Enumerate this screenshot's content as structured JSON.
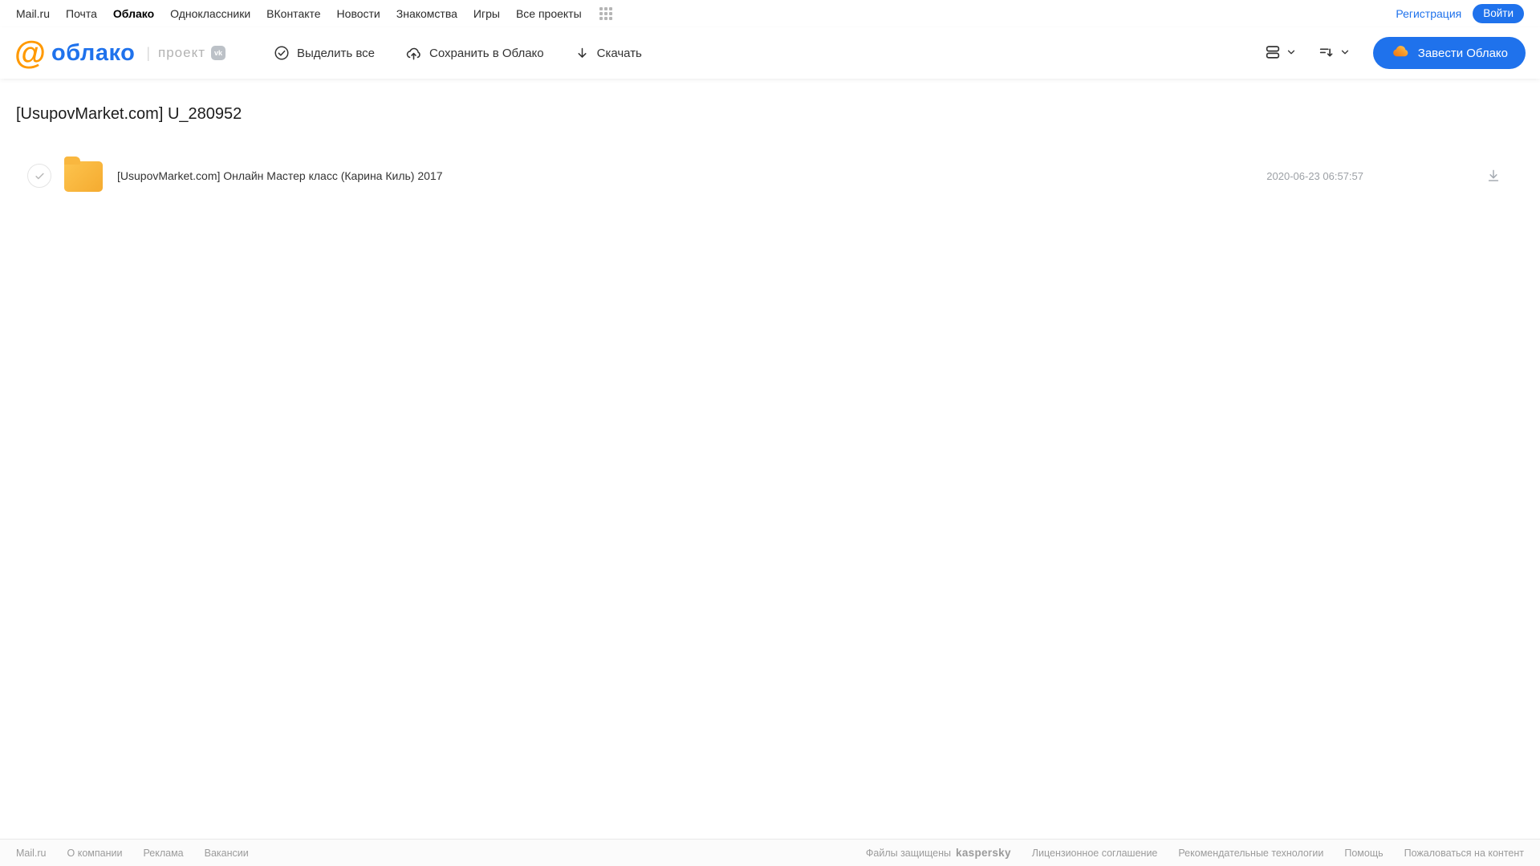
{
  "colors": {
    "accent_blue": "#1f72ec",
    "logo_orange": "#ff9900",
    "folder_yellow": "#f9b73f",
    "kaspersky_green": "#00a88e"
  },
  "topnav": {
    "links": [
      "Mail.ru",
      "Почта",
      "Облако",
      "Одноклассники",
      "ВКонтакте",
      "Новости",
      "Знакомства",
      "Игры",
      "Все проекты"
    ],
    "active_link": "Облако",
    "register": "Регистрация",
    "login": "Войти"
  },
  "header": {
    "logo": {
      "at_symbol": "@",
      "product": "облако",
      "divider": "|",
      "project": "проект",
      "vk_badge": "vk"
    },
    "toolbar": {
      "select_all": "Выделить все",
      "save_to_cloud": "Сохранить в Облако",
      "download": "Скачать"
    },
    "get_cloud_button": "Завести Облако"
  },
  "content": {
    "title": "[UsupovMarket.com] U_280952",
    "files": [
      {
        "name": "[UsupovMarket.com] Онлайн Мастер класс (Карина Киль) 2017",
        "modified": "2020-06-23 06:57:57",
        "type": "folder"
      }
    ]
  },
  "footer": {
    "left_links": [
      "Mail.ru",
      "О компании",
      "Реклама",
      "Вакансии"
    ],
    "protected_text": "Файлы защищены",
    "kaspersky": "kaspersky",
    "right_links": [
      "Лицензионное соглашение",
      "Рекомендательные технологии",
      "Помощь",
      "Пожаловаться на контент"
    ]
  }
}
